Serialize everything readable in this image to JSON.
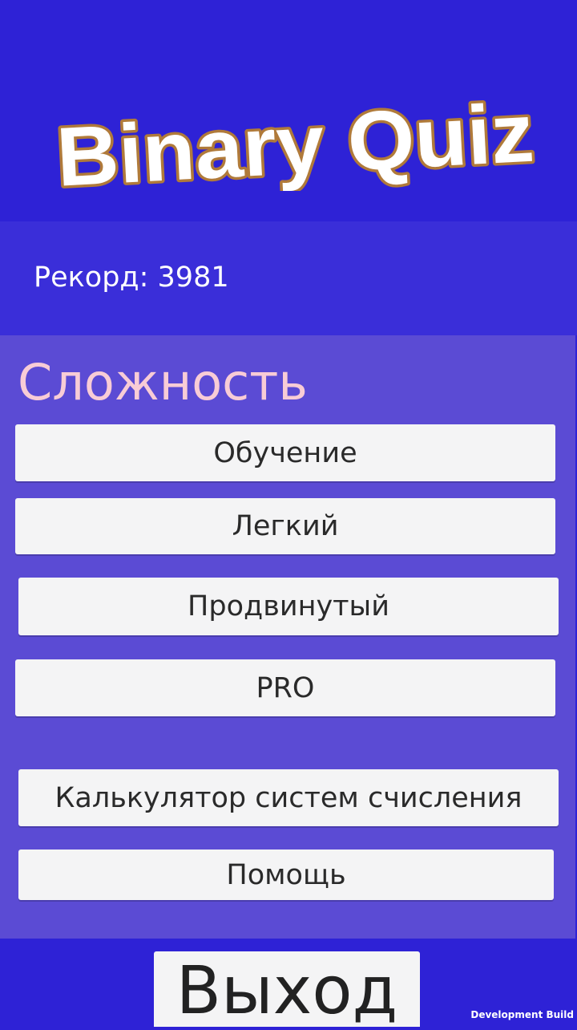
{
  "app": {
    "title": "Binary Quiz"
  },
  "record": {
    "label": "Рекорд: 3981"
  },
  "difficulty": {
    "title": "Сложность",
    "buttons": [
      {
        "label": "Обучение"
      },
      {
        "label": "Легкий"
      },
      {
        "label": "Продвинутый"
      },
      {
        "label": "PRO"
      }
    ]
  },
  "tools": {
    "calculator_label": "Калькулятор систем счисления",
    "help_label": "Помощь"
  },
  "exit": {
    "label": "Выход"
  },
  "footer": {
    "build_label": "Development Build"
  },
  "colors": {
    "background": "#2e22d6",
    "record_band": "#3a2ed9",
    "panel": "#5b4bd4",
    "button": "#f4f4f5",
    "title_pink": "#f8ccd6",
    "logo_fill": "#ffffff",
    "logo_outline": "#b07a3a"
  }
}
